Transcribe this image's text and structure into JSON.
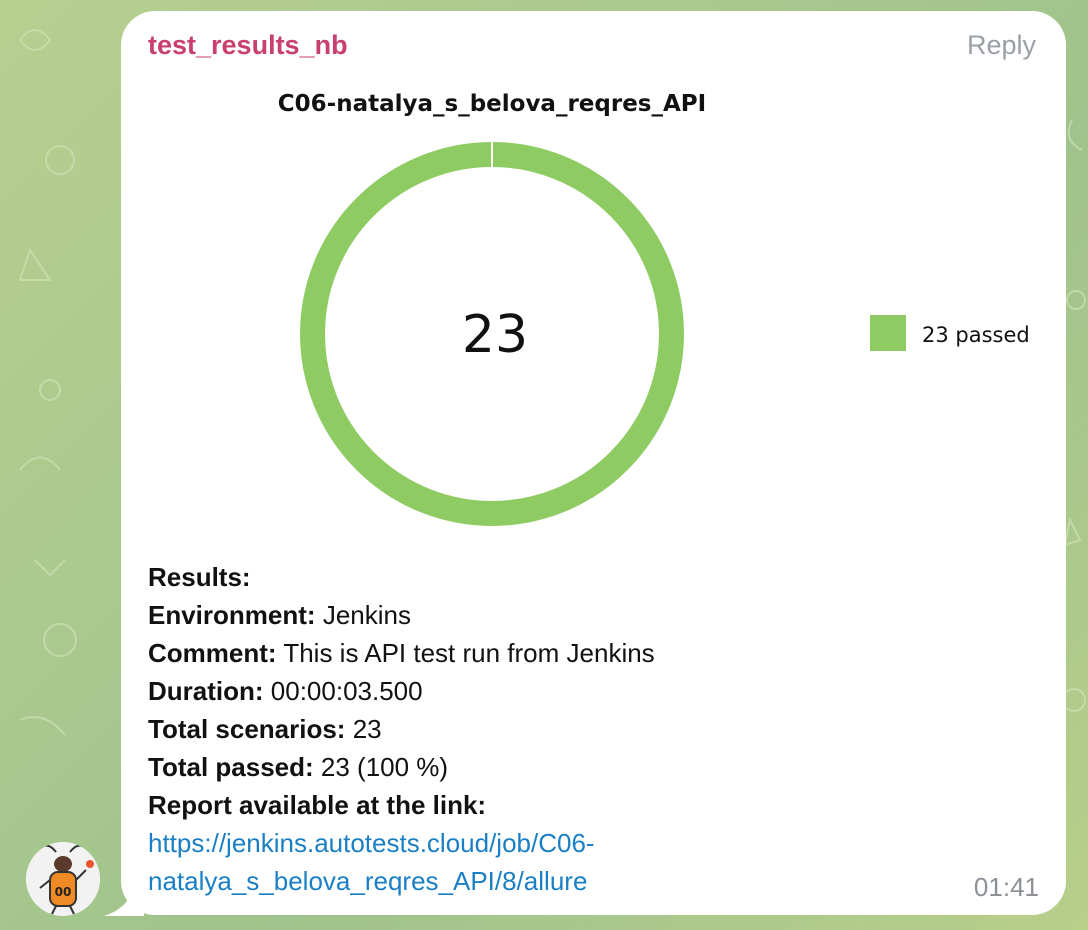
{
  "message": {
    "sender": "test_results_nb",
    "reply_label": "Reply",
    "time": "01:41",
    "results_heading": "Results:",
    "environment_label": "Environment:",
    "environment_value": "Jenkins",
    "comment_label": "Comment:",
    "comment_value": "This is API test run from Jenkins",
    "duration_label": "Duration:",
    "duration_value": "00:00:03.500",
    "total_scenarios_label": "Total scenarios:",
    "total_scenarios_value": "23",
    "total_passed_label": "Total passed:",
    "total_passed_value": "23 (100 %)",
    "report_label": "Report available at the link:",
    "report_link_line1": "https://jenkins.autotests.cloud/job/C06-",
    "report_link_line2": "natalya_s_belova_reqres_API/8/allure"
  },
  "chart_data": {
    "type": "pie",
    "title": "C06-natalya_s_belova_reqres_API",
    "center_label": "23",
    "slices": [
      {
        "label": "23 passed",
        "value": 23,
        "color": "#8fcb63"
      }
    ],
    "legend_position": "right"
  },
  "colors": {
    "sender": "#c9406f",
    "link": "#1a7fc4",
    "passed": "#8fcb63"
  }
}
